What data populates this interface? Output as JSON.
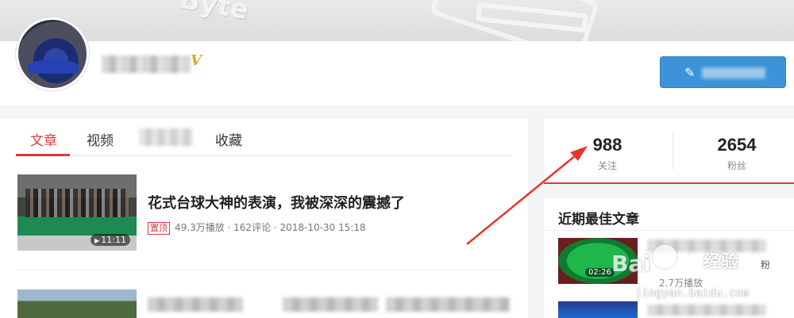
{
  "banner": {
    "word": "Byte"
  },
  "profile": {
    "verified_mark": "V",
    "edit_icon": "pencil-icon",
    "edit_glyph": "✎"
  },
  "tabs": [
    {
      "label": "文章",
      "active": true
    },
    {
      "label": "视频",
      "active": false
    },
    {
      "label": "收藏",
      "active": false
    }
  ],
  "articles": [
    {
      "title": "花式台球大神的表演，我被深深的震撼了",
      "badge": "置顶",
      "meta": "49.3万播放 · 162评论 · 2018-10-30 15:18",
      "duration": "11:11"
    }
  ],
  "stats": {
    "following": {
      "value": "988",
      "label": "关注"
    },
    "followers": {
      "value": "2654",
      "label": "粉丝"
    }
  },
  "best": {
    "title": "近期最佳文章",
    "item": {
      "duration": "02:26",
      "plays": "2.7万播放",
      "suffix": "粉"
    }
  },
  "watermark": {
    "brand": "Bai",
    "cn": "经验",
    "url": "jingyan.baidu.com"
  },
  "colors": {
    "accent": "#d43d3d",
    "button": "#3d93d9",
    "arrow": "#e8352c"
  }
}
